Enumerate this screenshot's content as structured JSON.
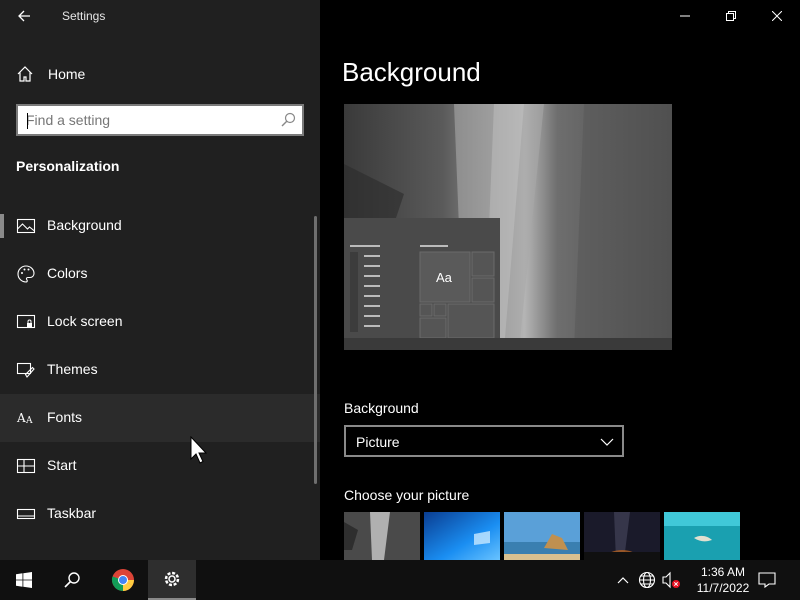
{
  "titlebar": {
    "app_title": "Settings"
  },
  "sidebar": {
    "home_label": "Home",
    "search_placeholder": "Find a setting",
    "section_title": "Personalization",
    "items": [
      {
        "label": "Background",
        "icon": "picture-icon",
        "selected": true
      },
      {
        "label": "Colors",
        "icon": "palette-icon"
      },
      {
        "label": "Lock screen",
        "icon": "lock-screen-icon"
      },
      {
        "label": "Themes",
        "icon": "brush-icon"
      },
      {
        "label": "Fonts",
        "icon": "font-icon",
        "hover": true
      },
      {
        "label": "Start",
        "icon": "start-icon"
      },
      {
        "label": "Taskbar",
        "icon": "taskbar-icon"
      }
    ]
  },
  "main": {
    "page_title": "Background",
    "preview_sample_text": "Aa",
    "background_field_label": "Background",
    "background_value": "Picture",
    "choose_label": "Choose your picture"
  },
  "taskbar": {
    "time": "1:36 AM",
    "date": "11/7/2022"
  },
  "colors": {
    "sidebar_bg": "#202020",
    "main_bg": "#000000",
    "taskbar_bg": "#101010"
  }
}
